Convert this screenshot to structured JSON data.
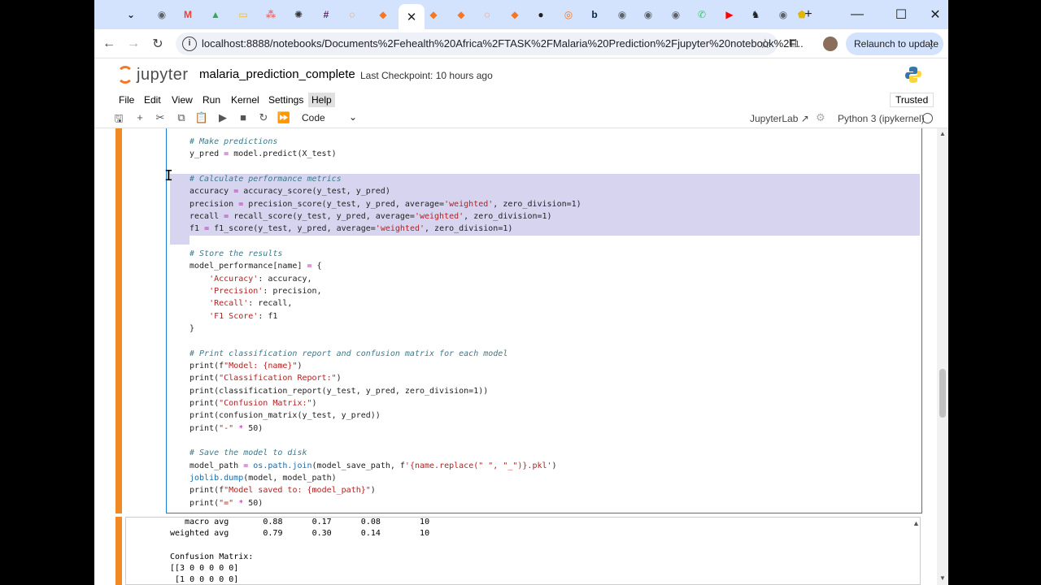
{
  "browser": {
    "tabs": [
      {
        "icon": "chevron-down-icon",
        "color": "#1f1f1f"
      },
      {
        "icon": "chrome-icon",
        "color": "#5f6368"
      },
      {
        "icon": "gmail-icon",
        "color": "#ea4335"
      },
      {
        "icon": "drive-icon",
        "color": "#34a853"
      },
      {
        "icon": "slides-icon",
        "color": "#fbbc04"
      },
      {
        "icon": "asana-icon",
        "color": "#f06a6a"
      },
      {
        "icon": "openai-icon",
        "color": "#333333"
      },
      {
        "icon": "slack-icon",
        "color": "#611f69"
      },
      {
        "icon": "loader-icon",
        "color": "#f37726"
      },
      {
        "icon": "folder-icon",
        "color": "#f37726"
      },
      {
        "icon": "close-icon",
        "color": "#1f1f1f"
      },
      {
        "icon": "folder-icon",
        "color": "#f37726"
      },
      {
        "icon": "folder-icon",
        "color": "#f37726"
      },
      {
        "icon": "loader-icon",
        "color": "#f37726"
      },
      {
        "icon": "folder-icon",
        "color": "#f37726"
      },
      {
        "icon": "github-icon",
        "color": "#1f1f1f"
      },
      {
        "icon": "jupyter-icon",
        "color": "#f37726"
      },
      {
        "icon": "b-icon",
        "color": "#0a2540"
      },
      {
        "icon": "chrome-icon",
        "color": "#5f6368"
      },
      {
        "icon": "chrome-icon",
        "color": "#5f6368"
      },
      {
        "icon": "chrome-icon",
        "color": "#5f6368"
      },
      {
        "icon": "whatsapp-icon",
        "color": "#25d366"
      },
      {
        "icon": "youtube-icon",
        "color": "#ff0000"
      },
      {
        "icon": "chess-icon",
        "color": "#1f1f1f"
      },
      {
        "icon": "chrome-icon",
        "color": "#5f6368"
      },
      {
        "icon": "shield-icon",
        "color": "#e3b500"
      }
    ],
    "new_tab": "+",
    "minimize": "—",
    "maximize": "☐",
    "close": "✕",
    "back": "←",
    "forward": "→",
    "reload": "↻",
    "url": "localhost:8888/notebooks/Documents%2Fehealth%20Africa%2FTASK%2FMalaria%20Prediction%2Fjupyter%20notebook%2F...",
    "relaunch": "Relaunch to update"
  },
  "jupyter": {
    "logo_text": "jupyter",
    "notebook_name": "malaria_prediction_complete",
    "checkpoint": "Last Checkpoint: 10 hours ago",
    "menus": [
      "File",
      "Edit",
      "View",
      "Run",
      "Kernel",
      "Settings",
      "Help"
    ],
    "trusted": "Trusted",
    "cell_type": "Code",
    "jupyterlab": "JupyterLab",
    "kernel": "Python 3 (ipykernel)"
  },
  "code": [
    {
      "t": "# Make predictions",
      "c": "comment"
    },
    {
      "t": "y_pred = model.predict(X_test)",
      "c": ""
    },
    {
      "t": "",
      "c": ""
    },
    {
      "t": "# Calculate performance metrics",
      "c": "comment"
    },
    {
      "t": "accuracy = accuracy_score(y_test, y_pred)",
      "c": ""
    },
    {
      "t": "precision = precision_score(y_test, y_pred, average='weighted', zero_division=1)",
      "c": ""
    },
    {
      "t": "recall = recall_score(y_test, y_pred, average='weighted', zero_division=1)",
      "c": ""
    },
    {
      "t": "f1 = f1_score(y_test, y_pred, average='weighted', zero_division=1)",
      "c": ""
    },
    {
      "t": "",
      "c": ""
    },
    {
      "t": "# Store the results",
      "c": "comment"
    },
    {
      "t": "model_performance[name] = {",
      "c": ""
    },
    {
      "t": "    'Accuracy': accuracy,",
      "c": ""
    },
    {
      "t": "    'Precision': precision,",
      "c": ""
    },
    {
      "t": "    'Recall': recall,",
      "c": ""
    },
    {
      "t": "    'F1 Score': f1",
      "c": ""
    },
    {
      "t": "}",
      "c": ""
    },
    {
      "t": "",
      "c": ""
    },
    {
      "t": "# Print classification report and confusion matrix for each model",
      "c": "comment"
    },
    {
      "t": "print(f\"Model: {name}\")",
      "c": ""
    },
    {
      "t": "print(\"Classification Report:\")",
      "c": ""
    },
    {
      "t": "print(classification_report(y_test, y_pred, zero_division=1))",
      "c": ""
    },
    {
      "t": "print(\"Confusion Matrix:\")",
      "c": ""
    },
    {
      "t": "print(confusion_matrix(y_test, y_pred))",
      "c": ""
    },
    {
      "t": "print(\"-\" * 50)",
      "c": ""
    },
    {
      "t": "",
      "c": ""
    },
    {
      "t": "# Save the model to disk",
      "c": "comment"
    },
    {
      "t": "model_path = os.path.join(model_save_path, f'{name.replace(\" \", \"_\")}.pkl')",
      "c": ""
    },
    {
      "t": "joblib.dump(model, model_path)",
      "c": ""
    },
    {
      "t": "print(f\"Model saved to: {model_path}\")",
      "c": ""
    },
    {
      "t": "print(\"=\" * 50)",
      "c": ""
    }
  ],
  "output": [
    "   macro avg       0.88      0.17      0.08        10",
    "weighted avg       0.79      0.30      0.14        10",
    "",
    "Confusion Matrix:",
    "[[3 0 0 0 0 0]",
    " [1 0 0 0 0 0]"
  ]
}
